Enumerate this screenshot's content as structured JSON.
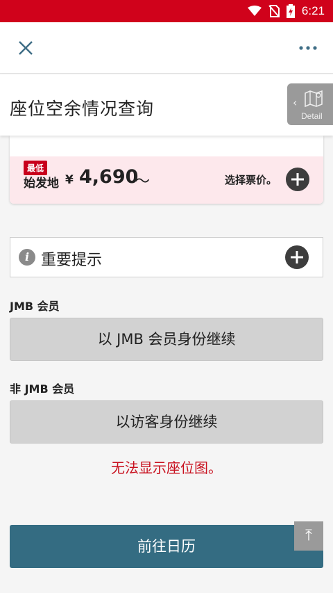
{
  "status_bar": {
    "time": "6:21"
  },
  "header": {
    "title": "座位空余情况查询"
  },
  "detail_tab": {
    "label": "Detail"
  },
  "price_card": {
    "badge": "最低",
    "origin": "始发地",
    "currency": "¥",
    "price": "4,690",
    "tilde": "～",
    "select_label": "选择票价。"
  },
  "notice": {
    "label": "重要提示"
  },
  "jmb": {
    "section_label": "JMB 会员",
    "button_label": "以 JMB 会员身份继续"
  },
  "non_jmb": {
    "section_label": "非 JMB 会员",
    "button_label": "以访客身份继续"
  },
  "error_message": "无法显示座位图。",
  "calendar_button": "前往日历",
  "colors": {
    "status_bar": "#d0021b",
    "primary_button": "#346c82",
    "error_text": "#c8101e",
    "badge": "#c8001c",
    "price_bg": "#fde8ec"
  }
}
